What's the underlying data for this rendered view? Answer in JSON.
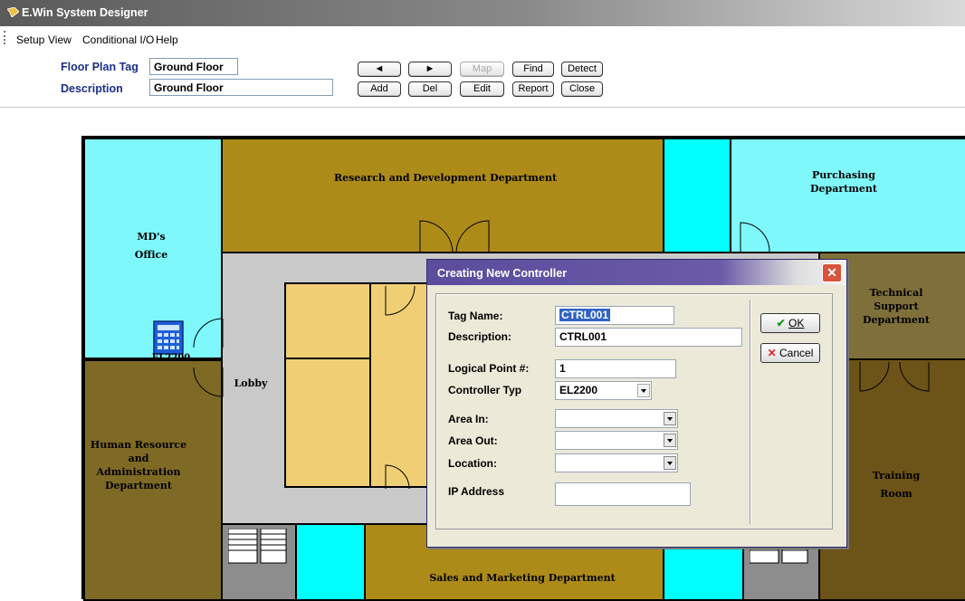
{
  "window": {
    "title": "E.Win System Designer"
  },
  "menu": {
    "items": [
      "Setup",
      "View",
      "Conditional I/O",
      "Help"
    ]
  },
  "toolbar": {
    "floor_plan_tag_label": "Floor Plan Tag",
    "floor_plan_tag_value": "Ground Floor",
    "description_label": "Description",
    "description_value": "Ground Floor",
    "buttons": {
      "prev": "◄",
      "next": "►",
      "map": "Map",
      "find": "Find",
      "detect": "Detect",
      "add": "Add",
      "del": "Del",
      "edit": "Edit",
      "report": "Report",
      "close": "Close"
    }
  },
  "floor_plan": {
    "rooms": {
      "rnd": "Research and Development Department",
      "purchasing": [
        "Purchasing",
        "Department"
      ],
      "md": [
        "MD's",
        "Office"
      ],
      "lobby": "Lobby",
      "hr": [
        "Human Resource",
        "and",
        "Administration",
        "Department"
      ],
      "tech": [
        "Technical",
        "Support",
        "Department"
      ],
      "training": [
        "Training",
        "Room"
      ],
      "sales": "Sales and Marketing Department"
    },
    "controller_label": "EL2200"
  },
  "dialog": {
    "title": "Creating New Controller",
    "fields": {
      "tag_name_label": "Tag Name:",
      "tag_name_value": "CTRL001",
      "description_label": "Description:",
      "description_value": "CTRL001",
      "logical_point_label": "Logical Point #:",
      "logical_point_value": "1",
      "controller_type_label": "Controller Typ",
      "controller_type_value": "EL2200",
      "area_in_label": "Area In:",
      "area_in_value": "",
      "area_out_label": "Area Out:",
      "area_out_value": "",
      "location_label": "Location:",
      "location_value": "",
      "ip_address_label": "IP Address",
      "ip_address_value": ""
    },
    "ok_label": "OK",
    "cancel_label": "Cancel"
  }
}
